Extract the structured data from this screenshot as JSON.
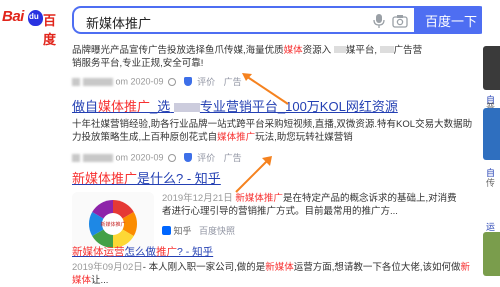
{
  "logo": {
    "bai": "Bai",
    "du": "百度"
  },
  "search": {
    "value": "新媒体推广",
    "button": "百度一下"
  },
  "result1": {
    "line1_a": "品牌曝光产品宣传广告投放选择鱼爪传媒,海量优质",
    "line1_red": "媒体",
    "line1_b": "资源入",
    "line1_c": "媒平台,",
    "line1_d": "广告营",
    "line2": "销服务平台,专业正规,安全可靠!",
    "date": "om 2020-09",
    "eval": "评价",
    "ad": "广告"
  },
  "result2": {
    "title_a": "做自",
    "title_red": "媒体推广",
    "title_b": "_选",
    "title_c": "专业营销平台_100万KOL网红资源",
    "line1": "十年社媒营销经验,助各行业品牌一站式跨平台采购短视频,直播,双微资源.特有KOL交易大数据助",
    "line2_a": "力投放策略生成,上百种原创花式自",
    "line2_red": "媒体推广",
    "line2_b": "玩法,助您玩转社媒营销",
    "date": "om 2020-09",
    "eval": "评价",
    "ad": "广告"
  },
  "result3": {
    "title_a": "新媒体推广",
    "title_b": "是什么? - 知乎",
    "date": "2019年12月21日",
    "desc_red": "新媒体推广",
    "desc_a": "是在特定产品的概念诉求的基础上,对消费",
    "desc_b": "者进行心理引导的营销推广方式。目前最常用的推广方...",
    "source": "知乎",
    "snapshot": "百度快照",
    "thumb_center": "新媒体推广",
    "sector_labels": [
      "目标",
      "内容",
      "渠道",
      "数据",
      "反馈",
      "优化"
    ]
  },
  "result4": {
    "title_a": "新媒体运营",
    "title_b": "怎么做",
    "title_c": "推广",
    "title_d": "? - 知乎",
    "date": "2019年09月02日",
    "desc_a": "- 本人刚入职一家公司,做的是",
    "desc_red": "新媒体",
    "desc_b": "运营方面,想请教一下各位大佬,该如何做",
    "desc_c": "新媒体",
    "desc_d": "让..."
  },
  "right": {
    "r1": "自",
    "r2": "普",
    "r3": "自",
    "r4": "传",
    "r5": "运"
  }
}
